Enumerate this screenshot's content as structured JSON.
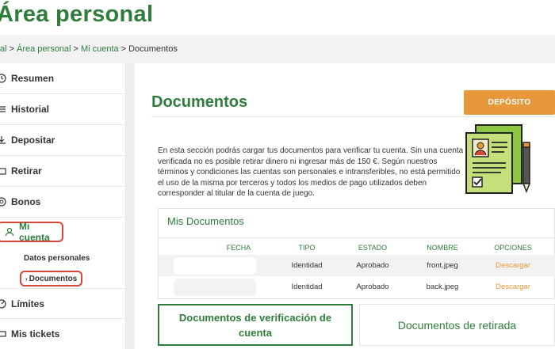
{
  "page": {
    "title": "Área personal"
  },
  "breadcrumb": {
    "items": [
      "Área personal",
      "Área personal",
      "Mi cuenta"
    ],
    "current": "Documentos",
    "first_visible": "al"
  },
  "sidebar": {
    "items": [
      {
        "label": "Resumen",
        "icon": "clock-icon"
      },
      {
        "label": "Historial",
        "icon": "list-icon"
      },
      {
        "label": "Depositar",
        "icon": "deposit-icon"
      },
      {
        "label": "Retirar",
        "icon": "withdraw-icon"
      },
      {
        "label": "Bonos",
        "icon": "coin-icon"
      },
      {
        "label": "Mi cuenta",
        "icon": "user-icon"
      },
      {
        "label": "Límites",
        "icon": "limit-icon"
      },
      {
        "label": "Mis tickets",
        "icon": "ticket-icon"
      }
    ],
    "subitems": [
      "Datos personales",
      "Documentos"
    ]
  },
  "main": {
    "title": "Documentos",
    "deposit_button": "DEPÓSITO",
    "intro": "En esta sección podrás cargar tus documentos para verificar tu cuenta. Sin una cuenta verificada no es posible retirar dinero ni ingresar más de 150 €. Según nuestros términos y condiciones las cuentas son personales e intransferibles, no está permitido el uso de la misma por terceros y todos los medios de pago utilizados deben corresponder al titular de la cuenta de juego."
  },
  "documents": {
    "panel_title": "Mis Documentos",
    "columns": [
      "FECHA",
      "TIPO",
      "ESTADO",
      "NOMBRE",
      "OPCIONES"
    ],
    "rows": [
      {
        "fecha": "",
        "tipo": "Identidad",
        "estado": "Aprobado",
        "nombre": "front.jpeg",
        "opciones": "Descargar"
      },
      {
        "fecha": "",
        "tipo": "Identidad",
        "estado": "Aprobado",
        "nombre": "back.jpeg",
        "opciones": "Descargar"
      }
    ]
  },
  "tabs": {
    "verification": "Documentos de verificación de cuenta",
    "withdrawal": "Documentos de retirada"
  },
  "colors": {
    "brand_green": "#2e7d3a",
    "accent_orange": "#e8973a",
    "highlight_red": "#d9453a"
  }
}
